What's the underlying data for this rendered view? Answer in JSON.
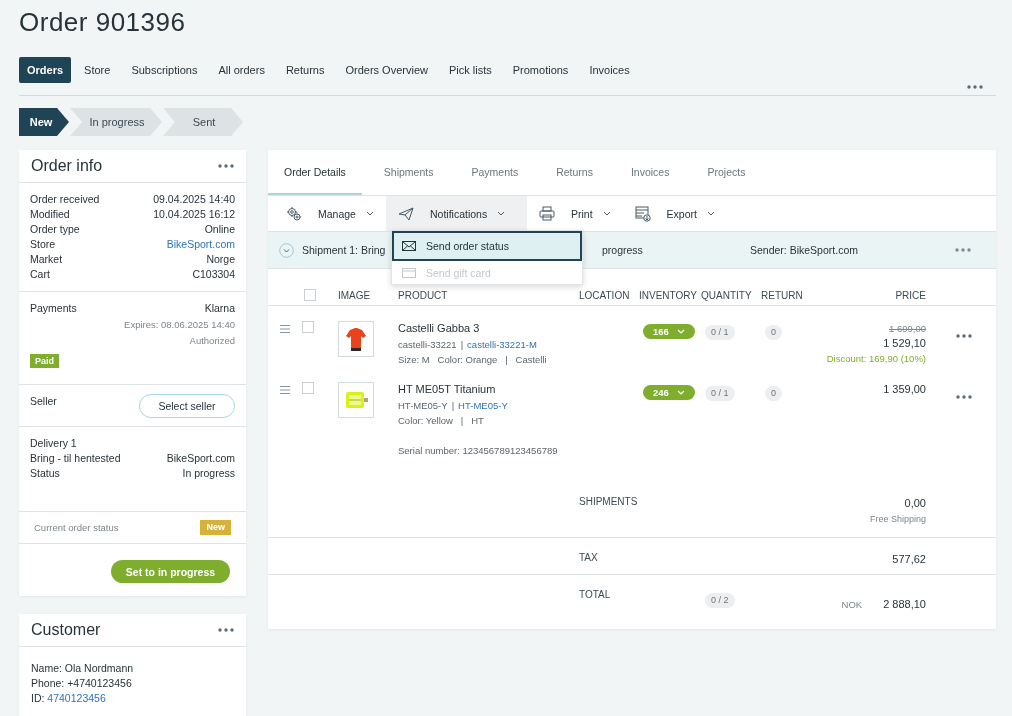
{
  "page_title": "Order 901396",
  "nav_tabs": [
    {
      "label": "Orders",
      "selected": true
    },
    {
      "label": "Store",
      "selected": false
    },
    {
      "label": "Subscriptions",
      "selected": false
    },
    {
      "label": "All orders",
      "selected": false
    },
    {
      "label": "Returns",
      "selected": false
    },
    {
      "label": "Orders Overview",
      "selected": false
    },
    {
      "label": "Pick lists",
      "selected": false
    },
    {
      "label": "Promotions",
      "selected": false
    },
    {
      "label": "Invoices",
      "selected": false
    }
  ],
  "steps": [
    {
      "label": "New",
      "selected": true
    },
    {
      "label": "In progress",
      "selected": false
    },
    {
      "label": "Sent",
      "selected": false
    }
  ],
  "order_info": {
    "title": "Order info",
    "fields": [
      {
        "label": "Order received",
        "value": "09.04.2025 14:40",
        "kind": "text"
      },
      {
        "label": "Modified",
        "value": "10.04.2025 16:12",
        "kind": "text"
      },
      {
        "label": "Order type",
        "value": "Online",
        "kind": "text"
      },
      {
        "label": "Store",
        "value": "BikeSport.com",
        "kind": "link"
      },
      {
        "label": "Market",
        "value": "Norge",
        "kind": "text"
      },
      {
        "label": "Cart",
        "value": "C103304",
        "kind": "text"
      }
    ],
    "payments": {
      "label": "Payments",
      "provider": "Klarna",
      "expires": "Expires: 08.06.2025 14:40",
      "status": "Authorized",
      "badge": "Paid"
    },
    "seller": {
      "label": "Seller",
      "button": "Select seller"
    },
    "delivery": {
      "title": "Delivery 1",
      "fields": [
        {
          "label": "Bring - til hentested",
          "value": "BikeSport.com"
        },
        {
          "label": "Status",
          "value": "In progress"
        }
      ]
    },
    "current_status": {
      "label": "Current order status",
      "badge": "New"
    },
    "action_button": "Set to in progress"
  },
  "customer": {
    "title": "Customer",
    "name": "Name: Ola Nordmann",
    "phone": "Phone: +4740123456",
    "id_label": "ID:",
    "id_value": "4740123456"
  },
  "detail_tabs": [
    {
      "label": "Order Details",
      "selected": true
    },
    {
      "label": "Shipments",
      "selected": false
    },
    {
      "label": "Payments",
      "selected": false
    },
    {
      "label": "Returns",
      "selected": false
    },
    {
      "label": "Invoices",
      "selected": false
    },
    {
      "label": "Projects",
      "selected": false
    }
  ],
  "toolbar": [
    {
      "label": "Manage",
      "open": false
    },
    {
      "label": "Notifications",
      "open": true
    },
    {
      "label": "Print",
      "open": false
    },
    {
      "label": "Export",
      "open": false
    }
  ],
  "notifications_menu": [
    {
      "label": "Send order status",
      "highlighted": true,
      "disabled": false
    },
    {
      "label": "Send gift card",
      "highlighted": false,
      "disabled": true
    }
  ],
  "shipment_bar": {
    "label_visible": "Shipment 1: Bring",
    "status_visible": "progress",
    "sender": "Sender: BikeSport.com"
  },
  "table": {
    "checked": false,
    "columns": [
      "IMAGE",
      "PRODUCT",
      "LOCATION",
      "INVENTORY",
      "QUANTITY",
      "RETURN",
      "PRICE"
    ],
    "rows": [
      {
        "checked": false,
        "name": "Castelli Gabba 3",
        "sku": "castelli-33221",
        "separator": "|",
        "variant_sku": "castelli-33221-M",
        "attributes": "Size: M   Color: Orange   |   Castelli",
        "inventory": "166",
        "quantity": "0 / 1",
        "returned": "0",
        "price_original": "1 699,00",
        "price": "1 529,10",
        "discount": "Discount: 169,90 (10%)"
      },
      {
        "checked": false,
        "name": "HT ME05T Titanium",
        "sku": "HT-ME05-Y",
        "separator": "|",
        "variant_sku": "HT-ME05-Y",
        "attributes": "Color: Yellow   |   HT",
        "serial": "Serial number: 123456789123456789",
        "inventory": "246",
        "quantity": "0 / 1",
        "returned": "0",
        "price": "1 359,00"
      }
    ]
  },
  "summary": [
    {
      "kind": "plain",
      "label": "SHIPMENTS",
      "value": "0,00",
      "note": "Free Shipping"
    },
    {
      "kind": "plain",
      "label": "TAX",
      "value": "577,62"
    },
    {
      "kind": "total",
      "label": "TOTAL",
      "quantity": "0 / 2",
      "currency": "NOK",
      "value": "2 888,10"
    }
  ]
}
